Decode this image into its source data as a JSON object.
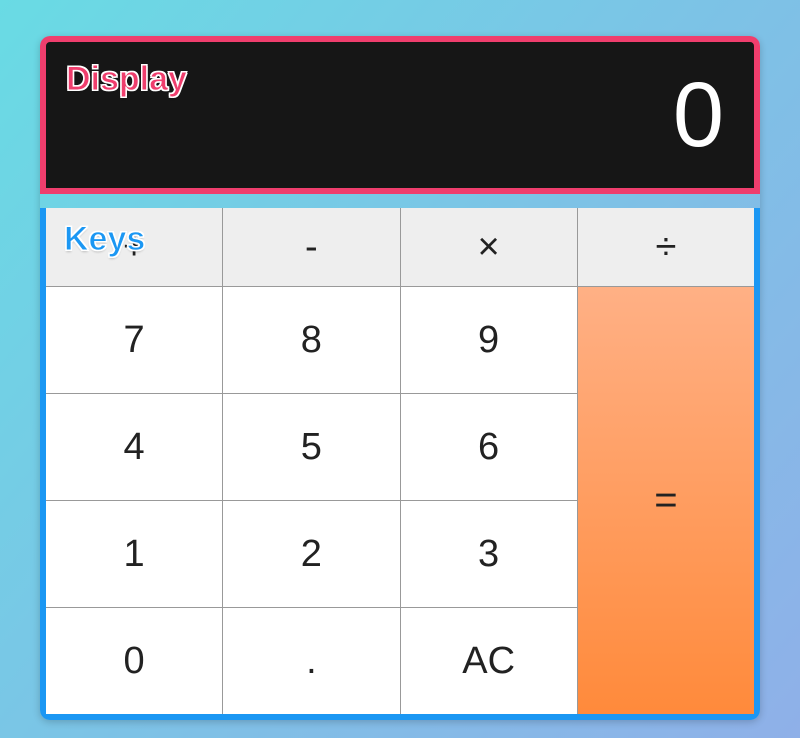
{
  "labels": {
    "display": "Display",
    "keys": "Keys"
  },
  "display": {
    "value": "0"
  },
  "keys": {
    "operators": {
      "add": "+",
      "subtract": "-",
      "multiply": "×",
      "divide": "÷"
    },
    "digits": {
      "d7": "7",
      "d8": "8",
      "d9": "9",
      "d4": "4",
      "d5": "5",
      "d6": "6",
      "d1": "1",
      "d2": "2",
      "d3": "3",
      "d0": "0"
    },
    "decimal": ".",
    "clear": "AC",
    "equals": "="
  }
}
